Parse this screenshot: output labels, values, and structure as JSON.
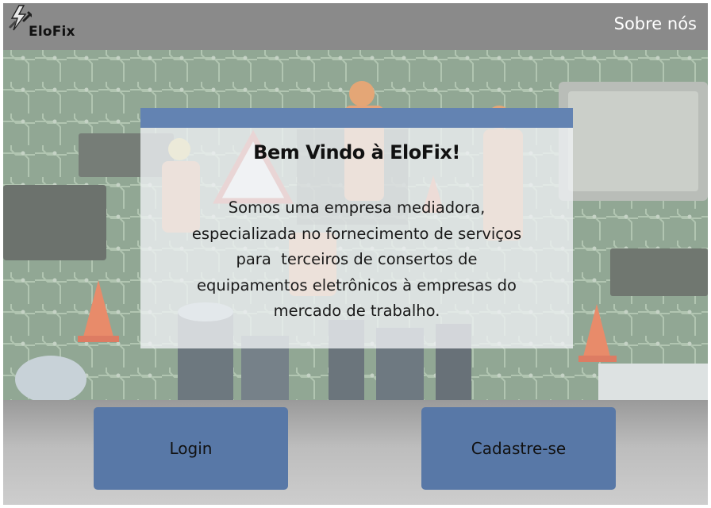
{
  "header": {
    "logo_text": "EloFix",
    "about_link": "Sobre nós"
  },
  "hero": {
    "title": "Bem Vindo à EloFix!",
    "description_lines": [
      "Somos uma empresa mediadora,",
      "especializada no fornecimento de serviços",
      "para  terceiros de consertos de",
      "equipamentos eletrônicos à empresas do",
      "mercado de trabalho."
    ]
  },
  "actions": {
    "login_label": "Login",
    "signup_label": "Cadastre-se"
  },
  "colors": {
    "header_bg": "#8a8a8a",
    "card_accent": "#6383b2",
    "button_bg": "#5878a7"
  },
  "icons": {
    "logo": "lightning-wrench-icon"
  }
}
